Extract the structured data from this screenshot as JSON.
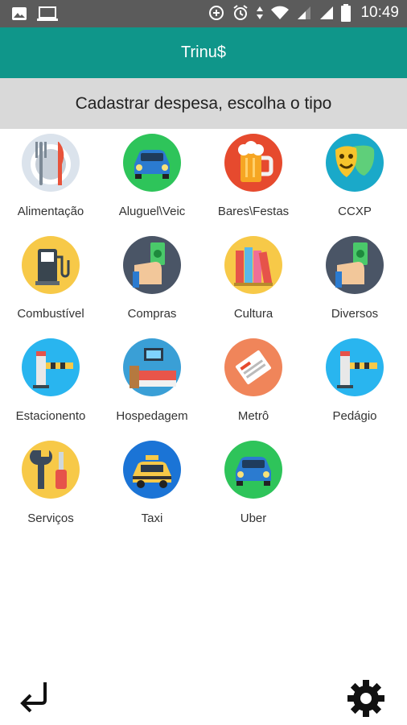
{
  "status_bar": {
    "time": "10:49",
    "icons_left": [
      "image-icon",
      "laptop-icon"
    ],
    "icons_right": [
      "data-saver-icon",
      "alarm-icon",
      "data-arrows-icon",
      "wifi-icon",
      "signal-icon",
      "signal-icon",
      "battery-icon"
    ]
  },
  "app_bar": {
    "title": "Trinu$"
  },
  "subheader": {
    "text": "Cadastrar despesa, escolha o tipo"
  },
  "categories": [
    {
      "label": "Alimentação",
      "icon": "cutlery-icon",
      "color": "#dbe3ec"
    },
    {
      "label": "Aluguel\\Veic",
      "icon": "car-icon",
      "color": "#2ec45a"
    },
    {
      "label": "Bares\\Festas",
      "icon": "beer-icon",
      "color": "#e64a2e"
    },
    {
      "label": "CCXP",
      "icon": "theater-masks-icon",
      "color": "#1aa9c9"
    },
    {
      "label": "Combustível",
      "icon": "fuel-pump-icon",
      "color": "#f7c948"
    },
    {
      "label": "Compras",
      "icon": "money-hand-icon",
      "color": "#4a5566"
    },
    {
      "label": "Cultura",
      "icon": "books-icon",
      "color": "#f7c948"
    },
    {
      "label": "Diversos",
      "icon": "money-hand-icon",
      "color": "#4a5566"
    },
    {
      "label": "Estacionento",
      "icon": "parking-barrier-icon",
      "color": "#29b5ef"
    },
    {
      "label": "Hospedagem",
      "icon": "bed-icon",
      "color": "#3a9fd6"
    },
    {
      "label": "Metrô",
      "icon": "ticket-icon",
      "color": "#f0855a"
    },
    {
      "label": "Pedágio",
      "icon": "toll-barrier-icon",
      "color": "#29b5ef"
    },
    {
      "label": "Serviços",
      "icon": "tools-icon",
      "color": "#f7c948"
    },
    {
      "label": "Taxi",
      "icon": "taxi-icon",
      "color": "#1b74d6"
    },
    {
      "label": "Uber",
      "icon": "car-icon",
      "color": "#2ec45a"
    }
  ],
  "bottom": {
    "back_icon": "back-return-icon",
    "settings_icon": "gear-icon"
  }
}
